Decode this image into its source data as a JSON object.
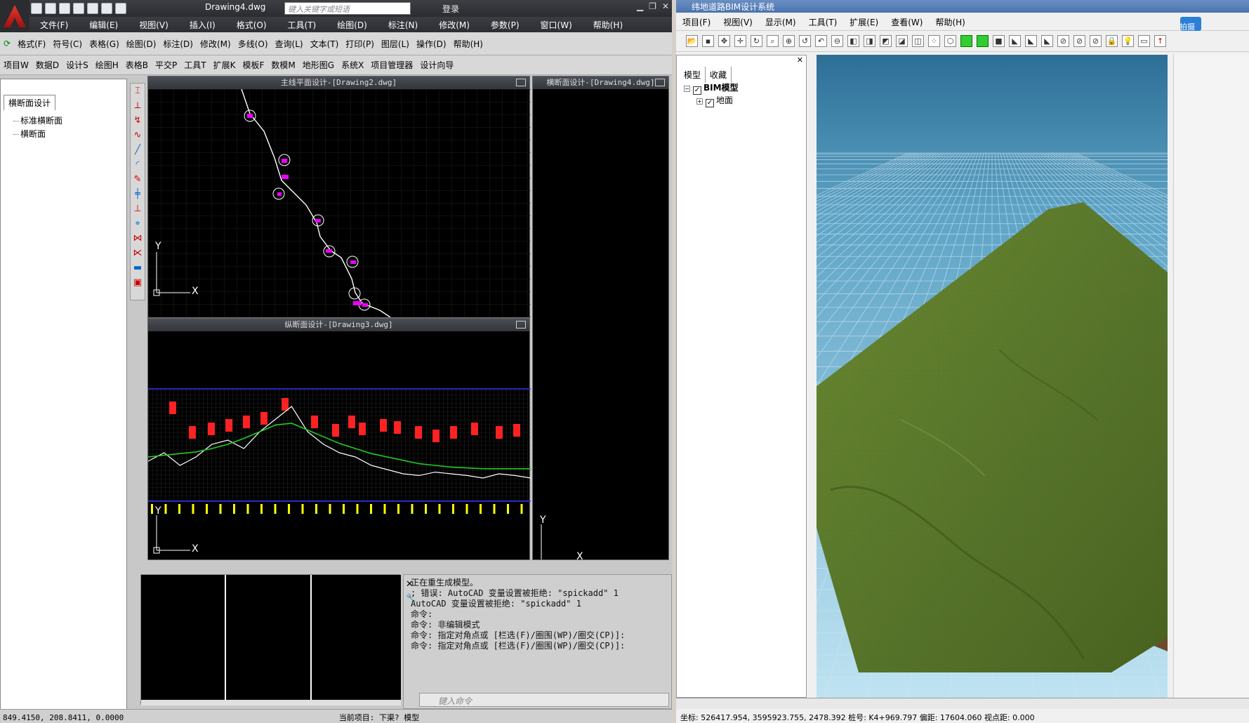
{
  "acad": {
    "doc_title": "Drawing4.dwg",
    "search_placeholder": "键入关键字或短语",
    "login": "登录",
    "menu": [
      "文件(F)",
      "编辑(E)",
      "视图(V)",
      "插入(I)",
      "格式(O)",
      "工具(T)",
      "绘图(D)",
      "标注(N)",
      "修改(M)",
      "参数(P)",
      "窗口(W)",
      "帮助(H)"
    ],
    "toolbar1": [
      "格式(F)",
      "符号(C)",
      "表格(G)",
      "绘图(D)",
      "标注(D)",
      "修改(M)",
      "多线(O)",
      "查询(L)",
      "文本(T)",
      "打印(P)",
      "图层(L)",
      "操作(D)",
      "帮助(H)"
    ],
    "toolbar2": [
      "项目W",
      "数据D",
      "设计S",
      "绘图H",
      "表格B",
      "平交P",
      "工具T",
      "扩展K",
      "模板F",
      "数模M",
      "地形图G",
      "系统X",
      "项目管理器",
      "设计向导"
    ],
    "panel": {
      "tab": "横断面设计",
      "items": [
        "标准横断面",
        "横断面"
      ]
    },
    "windows": {
      "plan": "主线平面设计-[Drawing2.dwg]",
      "profile": "纵断面设计-[Drawing3.dwg]",
      "cross": "横断面设计-[Drawing4.dwg]"
    },
    "ucs": {
      "x": "X",
      "y": "Y"
    },
    "command_lines": [
      "正在重生成模型。",
      "; 错误: AutoCAD 变量设置被拒绝: \"spickadd\" 1",
      "AutoCAD 变量设置被拒绝: \"spickadd\" 1",
      "命令:",
      "命令: 非编辑模式",
      "命令: 指定对角点或 [栏选(F)/圈围(WP)/圈交(CP)]:",
      "命令: 指定对角点或 [栏选(F)/圈围(WP)/圈交(CP)]:"
    ],
    "command_placeholder": "键入命令",
    "status": "849.4150, 208.8411, 0.0000",
    "status_right": "当前项目: 下渠?   模型"
  },
  "bim": {
    "title": "纬地道路BIM设计系统",
    "menu": [
      "项目(F)",
      "视图(V)",
      "显示(M)",
      "工具(T)",
      "扩展(E)",
      "查看(W)",
      "帮助(H)"
    ],
    "tree_tabs": [
      "模型",
      "收藏"
    ],
    "tree": {
      "root": "BIM模型",
      "child": "地面"
    },
    "side_label": "拍摄",
    "status": "坐标: 526417.954, 3595923.755, 2478.392  桩号: K4+969.797  偏距: 17604.060  视点距: 0.000",
    "colors": {
      "sky_top": "#2d6e96",
      "sky_bottom": "#8fc6de",
      "terrain": "#5e7a2a",
      "grid": "#cfe6f2"
    }
  },
  "chart_data": {
    "type": "line",
    "title": "纵断面设计-[Drawing3.dwg]",
    "series": [
      {
        "values": [
          0.35,
          0.45,
          0.3,
          0.4,
          0.55,
          0.6,
          0.5,
          0.7,
          0.85,
          1.0,
          0.7,
          0.55,
          0.45,
          0.4,
          0.3,
          0.25,
          0.2,
          0.18,
          0.22,
          0.2,
          0.18,
          0.15,
          0.2,
          0.18,
          0.15
        ]
      },
      {
        "values": [
          0.4,
          0.42,
          0.44,
          0.46,
          0.5,
          0.55,
          0.62,
          0.7,
          0.78,
          0.8,
          0.72,
          0.64,
          0.56,
          0.5,
          0.44,
          0.4,
          0.36,
          0.32,
          0.3,
          0.28,
          0.27,
          0.26,
          0.26,
          0.26,
          0.26
        ]
      }
    ]
  }
}
